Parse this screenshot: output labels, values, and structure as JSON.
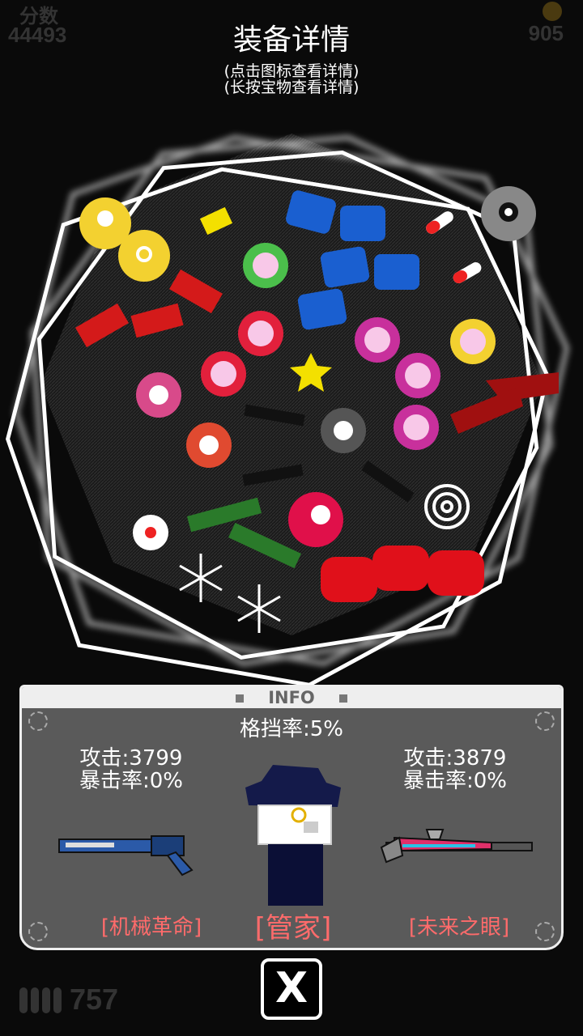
{
  "hud": {
    "score_label": "分数",
    "score_value": "44493",
    "coins_value": "905",
    "ammo_value": "757"
  },
  "header": {
    "title": "装备详情",
    "hint1": "(点击图标查看详情)",
    "hint2": "(长按宝物查看详情)"
  },
  "info": {
    "header_label": "INFO",
    "block_rate": "格挡率:5%",
    "left_weapon": {
      "attack": "攻击:3799",
      "crit": "暴击率:0%",
      "name": "[机械革命]"
    },
    "character": {
      "name": "[管家]"
    },
    "right_weapon": {
      "attack": "攻击:3879",
      "crit": "暴击率:0%",
      "name": "[未来之眼]"
    }
  },
  "close_button": {
    "label": "X"
  },
  "colors": {
    "accent_red": "#ff6b6b",
    "panel_bg": "#5a5a5a",
    "panel_border": "#eeeeee"
  }
}
